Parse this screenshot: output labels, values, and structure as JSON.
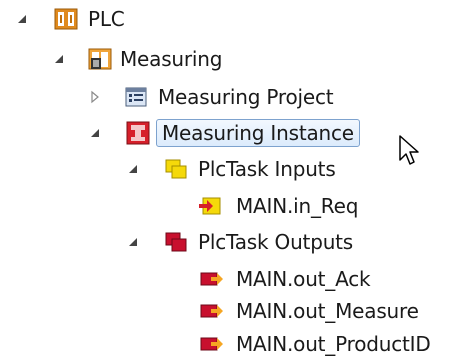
{
  "tree": {
    "root": {
      "label": "PLC",
      "expanded": true,
      "icon": "plc-folder-icon",
      "children": {
        "measuring": {
          "label": "Measuring",
          "expanded": true,
          "icon": "plc-project-icon",
          "project": {
            "label": "Measuring Project",
            "expanded": false,
            "icon": "project-file-icon"
          },
          "instance": {
            "label": "Measuring Instance",
            "expanded": true,
            "selected": true,
            "icon": "plc-instance-icon",
            "inputs": {
              "label": "PlcTask Inputs",
              "expanded": true,
              "icon": "input-folder-icon",
              "items": [
                {
                  "label": "MAIN.in_Req",
                  "icon": "input-variable-icon"
                }
              ]
            },
            "outputs": {
              "label": "PlcTask Outputs",
              "expanded": true,
              "icon": "output-folder-icon",
              "items": [
                {
                  "label": "MAIN.out_Ack",
                  "icon": "output-variable-icon"
                },
                {
                  "label": "MAIN.out_Measure",
                  "icon": "output-variable-icon"
                },
                {
                  "label": "MAIN.out_ProductID",
                  "icon": "output-variable-icon"
                }
              ]
            }
          }
        }
      }
    }
  },
  "colors": {
    "selection_border": "#7da2ce",
    "selection_fill": "#dcebfc",
    "input_yellow": "#f5d90a",
    "output_red": "#c8102e"
  }
}
